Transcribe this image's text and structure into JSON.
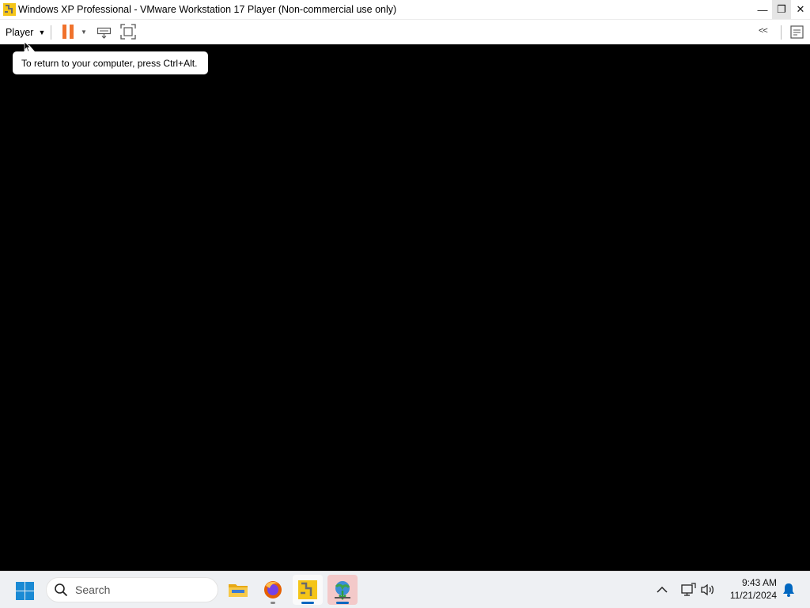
{
  "window": {
    "title": "Windows XP Professional - VMware Workstation 17 Player (Non-commercial use only)",
    "controls": {
      "minimize": "—",
      "restore": "❐",
      "close": "✕"
    }
  },
  "toolbar": {
    "player_menu_label": "Player",
    "caret": "▼",
    "pause_dropdown": "▼",
    "collapse_label": "<<"
  },
  "vm": {
    "tooltip_text": "To return to your computer, press Ctrl+Alt."
  },
  "taskbar": {
    "search_placeholder": "Search",
    "apps": [
      {
        "name": "File Explorer",
        "icon": "folder-icon",
        "active": false
      },
      {
        "name": "Firefox",
        "icon": "firefox-icon",
        "active": false
      },
      {
        "name": "VMware Workstation Player",
        "icon": "vmware-icon",
        "active": true
      },
      {
        "name": "Internet Download Manager",
        "icon": "idm-icon",
        "active": true
      }
    ],
    "clock": {
      "time": "9:43 AM",
      "date": "11/21/2024"
    }
  },
  "colors": {
    "pause_accent": "#f0722c",
    "win_blue": "#1a8ad4",
    "indicator_blue": "#0067c0",
    "vm_background": "#000000"
  }
}
